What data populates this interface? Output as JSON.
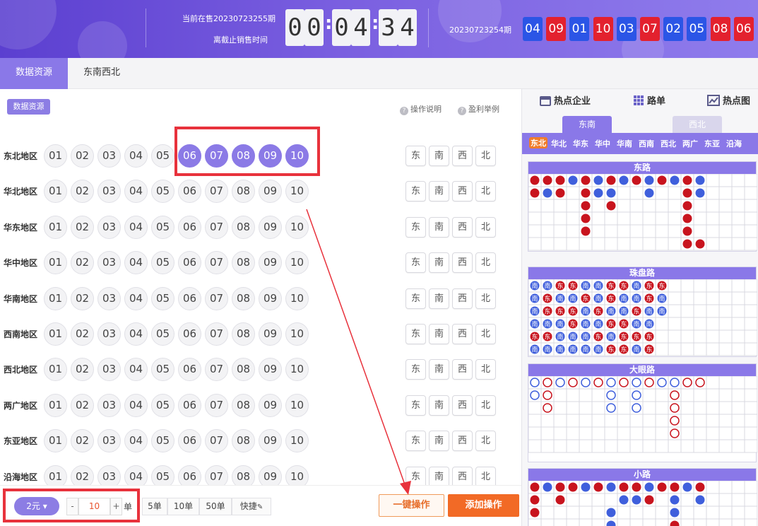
{
  "header": {
    "current_issue_text": "当前在售20230723255期",
    "deadline_text": "离截止销售时间",
    "countdown": [
      "0",
      "0",
      "0",
      "4",
      "3",
      "4"
    ],
    "last_issue": "20230723254期",
    "results": [
      {
        "num": "04",
        "color": "blue"
      },
      {
        "num": "09",
        "color": "red"
      },
      {
        "num": "01",
        "color": "blue"
      },
      {
        "num": "10",
        "color": "red"
      },
      {
        "num": "03",
        "color": "blue"
      },
      {
        "num": "07",
        "color": "red"
      },
      {
        "num": "02",
        "color": "blue"
      },
      {
        "num": "05",
        "color": "blue"
      },
      {
        "num": "08",
        "color": "red"
      },
      {
        "num": "06",
        "color": "red"
      }
    ]
  },
  "tabs": [
    {
      "label": "数据资源",
      "active": true
    },
    {
      "label": "东南西北",
      "active": false
    }
  ],
  "left": {
    "data_btn": "数据资源",
    "help": [
      "操作说明",
      "盈利举例"
    ],
    "numbers": [
      "01",
      "02",
      "03",
      "04",
      "05",
      "06",
      "07",
      "08",
      "09",
      "10"
    ],
    "dir_buttons": [
      "东",
      "南",
      "西",
      "北"
    ],
    "rows": [
      {
        "label": "东北地区",
        "selected": [
          "06",
          "07",
          "08",
          "09",
          "10"
        ]
      },
      {
        "label": "华北地区",
        "selected": []
      },
      {
        "label": "华东地区",
        "selected": []
      },
      {
        "label": "华中地区",
        "selected": []
      },
      {
        "label": "华南地区",
        "selected": []
      },
      {
        "label": "西南地区",
        "selected": []
      },
      {
        "label": "西北地区",
        "selected": []
      },
      {
        "label": "两广地区",
        "selected": []
      },
      {
        "label": "东亚地区",
        "selected": []
      },
      {
        "label": "沿海地区",
        "selected": []
      }
    ]
  },
  "bottom": {
    "unit": "2元",
    "minus": "-",
    "qty": "10",
    "plus": "+",
    "qty_unit": "单",
    "quick": [
      "5单",
      "10单",
      "50单"
    ],
    "shortcut": "快捷",
    "one_click": "一键操作",
    "add": "添加操作"
  },
  "right": {
    "tabs": [
      "热点企业",
      "路单",
      "热点图"
    ],
    "subtabs": [
      "东南",
      "西北"
    ],
    "regions": [
      "东北",
      "华北",
      "华东",
      "华中",
      "华南",
      "西南",
      "西北",
      "两广",
      "东亚",
      "沿海"
    ],
    "panels": [
      "东路",
      "珠盘路",
      "大眼路",
      "小路"
    ],
    "bead_symbols": [
      "南",
      "东"
    ],
    "colors": {
      "red": "#c8141e",
      "blue": "#3f5fdc",
      "accent": "#8a78e8",
      "orange": "#f07c2c"
    },
    "grid_dong": {
      "cols": 18,
      "rows": 6,
      "cells": [
        [
          0,
          0,
          "r"
        ],
        [
          1,
          0,
          "r"
        ],
        [
          2,
          0,
          "r"
        ],
        [
          3,
          0,
          "b"
        ],
        [
          4,
          0,
          "r"
        ],
        [
          5,
          0,
          "b"
        ],
        [
          6,
          0,
          "r"
        ],
        [
          7,
          0,
          "b"
        ],
        [
          8,
          0,
          "r"
        ],
        [
          9,
          0,
          "b"
        ],
        [
          10,
          0,
          "r"
        ],
        [
          11,
          0,
          "b"
        ],
        [
          12,
          0,
          "r"
        ],
        [
          13,
          0,
          "b"
        ],
        [
          0,
          1,
          "r"
        ],
        [
          1,
          1,
          "b"
        ],
        [
          2,
          1,
          "r"
        ],
        [
          4,
          1,
          "r"
        ],
        [
          5,
          1,
          "b"
        ],
        [
          6,
          1,
          "b"
        ],
        [
          9,
          1,
          "b"
        ],
        [
          12,
          1,
          "r"
        ],
        [
          13,
          1,
          "b"
        ],
        [
          4,
          2,
          "r"
        ],
        [
          6,
          2,
          "r"
        ],
        [
          12,
          2,
          "r"
        ],
        [
          4,
          3,
          "r"
        ],
        [
          12,
          3,
          "r"
        ],
        [
          4,
          4,
          "r"
        ],
        [
          12,
          4,
          "r"
        ],
        [
          12,
          5,
          "r"
        ],
        [
          13,
          5,
          "r"
        ]
      ]
    },
    "grid_bead": {
      "cols": 18,
      "rows": 6,
      "cells": [
        [
          0,
          0,
          "b"
        ],
        [
          1,
          0,
          "b"
        ],
        [
          2,
          0,
          "r"
        ],
        [
          3,
          0,
          "r"
        ],
        [
          4,
          0,
          "b"
        ],
        [
          5,
          0,
          "b"
        ],
        [
          6,
          0,
          "r"
        ],
        [
          7,
          0,
          "r"
        ],
        [
          8,
          0,
          "b"
        ],
        [
          9,
          0,
          "r"
        ],
        [
          10,
          0,
          "r"
        ],
        [
          0,
          1,
          "b"
        ],
        [
          1,
          1,
          "r"
        ],
        [
          2,
          1,
          "b"
        ],
        [
          3,
          1,
          "b"
        ],
        [
          4,
          1,
          "r"
        ],
        [
          5,
          1,
          "b"
        ],
        [
          6,
          1,
          "r"
        ],
        [
          7,
          1,
          "b"
        ],
        [
          8,
          1,
          "b"
        ],
        [
          9,
          1,
          "r"
        ],
        [
          10,
          1,
          "b"
        ],
        [
          0,
          2,
          "b"
        ],
        [
          1,
          2,
          "r"
        ],
        [
          2,
          2,
          "r"
        ],
        [
          3,
          2,
          "r"
        ],
        [
          4,
          2,
          "b"
        ],
        [
          5,
          2,
          "r"
        ],
        [
          6,
          2,
          "b"
        ],
        [
          7,
          2,
          "b"
        ],
        [
          8,
          2,
          "r"
        ],
        [
          9,
          2,
          "b"
        ],
        [
          10,
          2,
          "b"
        ],
        [
          0,
          3,
          "b"
        ],
        [
          1,
          3,
          "b"
        ],
        [
          2,
          3,
          "b"
        ],
        [
          3,
          3,
          "r"
        ],
        [
          4,
          3,
          "b"
        ],
        [
          5,
          3,
          "b"
        ],
        [
          6,
          3,
          "r"
        ],
        [
          7,
          3,
          "r"
        ],
        [
          8,
          3,
          "b"
        ],
        [
          9,
          3,
          "b"
        ],
        [
          0,
          4,
          "r"
        ],
        [
          1,
          4,
          "r"
        ],
        [
          2,
          4,
          "b"
        ],
        [
          3,
          4,
          "b"
        ],
        [
          4,
          4,
          "b"
        ],
        [
          5,
          4,
          "r"
        ],
        [
          6,
          4,
          "b"
        ],
        [
          7,
          4,
          "r"
        ],
        [
          8,
          4,
          "r"
        ],
        [
          9,
          4,
          "r"
        ],
        [
          0,
          5,
          "b"
        ],
        [
          1,
          5,
          "b"
        ],
        [
          2,
          5,
          "b"
        ],
        [
          3,
          5,
          "b"
        ],
        [
          4,
          5,
          "b"
        ],
        [
          5,
          5,
          "b"
        ],
        [
          6,
          5,
          "r"
        ],
        [
          7,
          5,
          "r"
        ],
        [
          8,
          5,
          "b"
        ],
        [
          9,
          5,
          "r"
        ]
      ]
    },
    "grid_big": {
      "cols": 18,
      "rows": 6,
      "cells": [
        [
          0,
          0,
          "b"
        ],
        [
          1,
          0,
          "r"
        ],
        [
          2,
          0,
          "b"
        ],
        [
          3,
          0,
          "r"
        ],
        [
          4,
          0,
          "b"
        ],
        [
          5,
          0,
          "r"
        ],
        [
          6,
          0,
          "b"
        ],
        [
          7,
          0,
          "r"
        ],
        [
          8,
          0,
          "b"
        ],
        [
          9,
          0,
          "r"
        ],
        [
          10,
          0,
          "b"
        ],
        [
          11,
          0,
          "b"
        ],
        [
          12,
          0,
          "r"
        ],
        [
          13,
          0,
          "r"
        ],
        [
          0,
          1,
          "b"
        ],
        [
          1,
          1,
          "r"
        ],
        [
          6,
          1,
          "b"
        ],
        [
          8,
          1,
          "b"
        ],
        [
          11,
          1,
          "r"
        ],
        [
          1,
          2,
          "r"
        ],
        [
          6,
          2,
          "b"
        ],
        [
          8,
          2,
          "b"
        ],
        [
          11,
          2,
          "r"
        ],
        [
          11,
          3,
          "r"
        ],
        [
          11,
          4,
          "r"
        ]
      ]
    },
    "grid_small": {
      "cols": 18,
      "rows": 4,
      "cells": [
        [
          0,
          0,
          "r"
        ],
        [
          1,
          0,
          "b"
        ],
        [
          2,
          0,
          "r"
        ],
        [
          3,
          0,
          "r"
        ],
        [
          4,
          0,
          "b"
        ],
        [
          5,
          0,
          "r"
        ],
        [
          6,
          0,
          "b"
        ],
        [
          7,
          0,
          "r"
        ],
        [
          8,
          0,
          "r"
        ],
        [
          9,
          0,
          "b"
        ],
        [
          10,
          0,
          "r"
        ],
        [
          11,
          0,
          "r"
        ],
        [
          12,
          0,
          "b"
        ],
        [
          13,
          0,
          "r"
        ],
        [
          0,
          1,
          "r"
        ],
        [
          2,
          1,
          "r"
        ],
        [
          7,
          1,
          "b"
        ],
        [
          8,
          1,
          "b"
        ],
        [
          9,
          1,
          "r"
        ],
        [
          11,
          1,
          "b"
        ],
        [
          13,
          1,
          "b"
        ],
        [
          0,
          2,
          "r"
        ],
        [
          6,
          2,
          "b"
        ],
        [
          11,
          2,
          "b"
        ],
        [
          11,
          3,
          "r"
        ],
        [
          6,
          3,
          "b"
        ]
      ]
    }
  }
}
